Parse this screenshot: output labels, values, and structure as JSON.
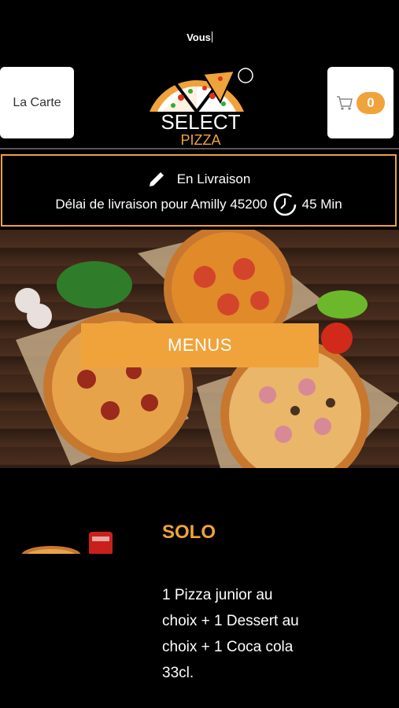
{
  "status": {
    "text": "Vous"
  },
  "header": {
    "menu_button": "La Carte",
    "cart_count": "0",
    "logo_line1": "SELECT",
    "logo_line2": "PIZZA"
  },
  "delivery": {
    "mode": "En Livraison",
    "delay_text": "Délai de livraison pour Amilly 45200",
    "duration": "45 Min"
  },
  "hero": {
    "button_label": "MENUS"
  },
  "offer": {
    "title": "SOLO",
    "description": "1 Pizza junior au choix  + 1 Dessert au choix  + 1 Coca cola 33cl."
  },
  "colors": {
    "accent": "#f0a33a",
    "background": "#000000"
  }
}
